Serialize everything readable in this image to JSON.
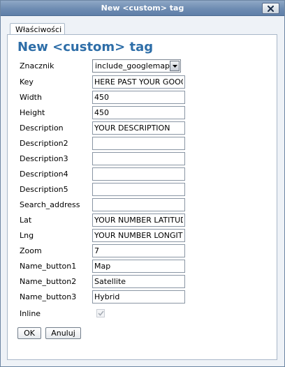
{
  "window": {
    "title": "New <custom> tag"
  },
  "tabs": [
    {
      "label": "Właściwości"
    }
  ],
  "heading": "New <custom> tag",
  "form": {
    "znacznik": {
      "label": "Znacznik",
      "value": "include_googlemaps"
    },
    "key": {
      "label": "Key",
      "value": "HERE PAST YOUR GOOGLE KEY"
    },
    "width": {
      "label": "Width",
      "value": "450"
    },
    "height": {
      "label": "Height",
      "value": "450"
    },
    "description": {
      "label": "Description",
      "value": "YOUR DESCRIPTION"
    },
    "description2": {
      "label": "Description2",
      "value": ""
    },
    "description3": {
      "label": "Description3",
      "value": ""
    },
    "description4": {
      "label": "Description4",
      "value": ""
    },
    "description5": {
      "label": "Description5",
      "value": ""
    },
    "search_address": {
      "label": "Search_address",
      "value": ""
    },
    "lat": {
      "label": "Lat",
      "value": "YOUR NUMBER LATITUDE"
    },
    "lng": {
      "label": "Lng",
      "value": "YOUR NUMBER LONGITUDE"
    },
    "zoom": {
      "label": "Zoom",
      "value": "7"
    },
    "name_button1": {
      "label": "Name_button1",
      "value": "Map"
    },
    "name_button2": {
      "label": "Name_button2",
      "value": "Satellite"
    },
    "name_button3": {
      "label": "Name_button3",
      "value": "Hybrid"
    },
    "inline": {
      "label": "Inline",
      "checked": true,
      "disabled": true
    }
  },
  "buttons": {
    "ok": "OK",
    "cancel": "Anuluj"
  },
  "colors": {
    "heading": "#2e6ea8",
    "titlebar": "#6e8cb2"
  }
}
